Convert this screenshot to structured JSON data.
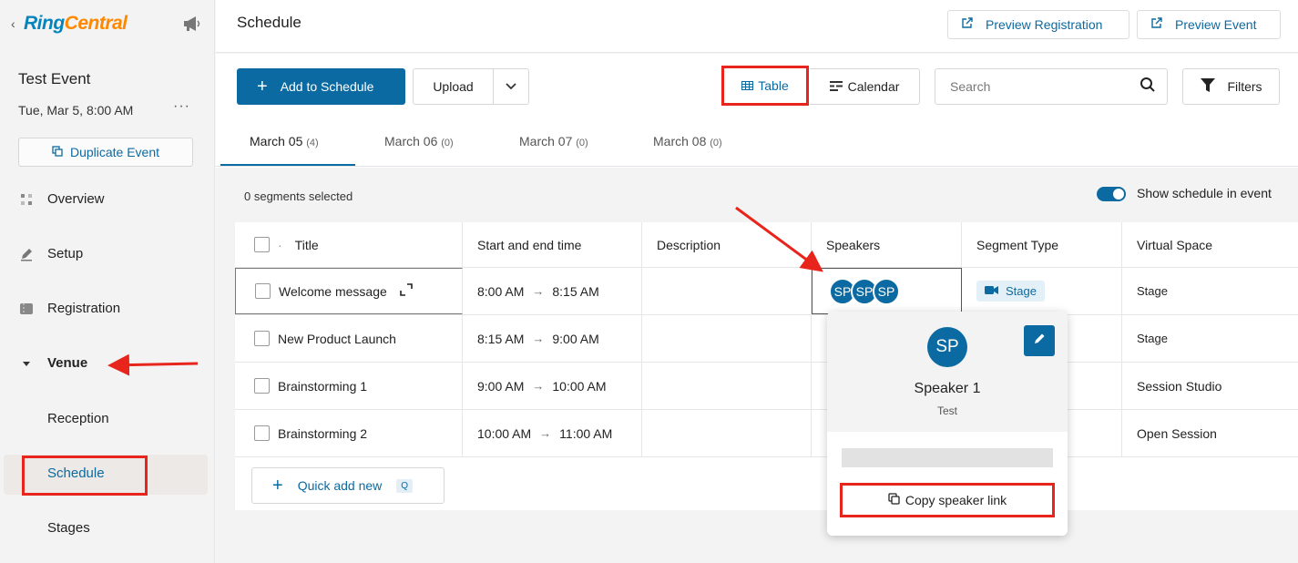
{
  "brand": {
    "logo_ring": "Ring",
    "logo_central": "Central",
    "back_icon": "chevron-left-icon",
    "announce_icon": "megaphone-icon"
  },
  "event": {
    "title": "Test Event",
    "date": "Tue, Mar 5, 8:00 AM",
    "more": "···",
    "duplicate_label": "Duplicate Event"
  },
  "nav": {
    "overview": "Overview",
    "setup": "Setup",
    "registration": "Registration",
    "venue": "Venue",
    "reception": "Reception",
    "schedule": "Schedule",
    "stages": "Stages"
  },
  "header": {
    "title": "Schedule",
    "preview_registration": "Preview Registration",
    "preview_event": "Preview Event"
  },
  "toolbar": {
    "add_label": "Add to Schedule",
    "upload_label": "Upload",
    "table_label": "Table",
    "calendar_label": "Calendar",
    "search_placeholder": "Search",
    "filters_label": "Filters"
  },
  "tabs": [
    {
      "label": "March 05",
      "count": "(4)"
    },
    {
      "label": "March 06",
      "count": "(0)"
    },
    {
      "label": "March 07",
      "count": "(0)"
    },
    {
      "label": "March 08",
      "count": "(0)"
    }
  ],
  "selection": {
    "text": "0 segments selected",
    "toggle_label": "Show schedule in event",
    "toggle_on": true
  },
  "table": {
    "columns": [
      "Title",
      "Start and end time",
      "Description",
      "Speakers",
      "Segment Type",
      "Virtual Space"
    ],
    "title_dot": "·",
    "rows": [
      {
        "title": "Welcome message",
        "start": "8:00 AM",
        "end": "8:15 AM",
        "description": "",
        "speakers": [
          "SP",
          "SP",
          "SP"
        ],
        "segment_type": "Stage",
        "virtual_space": "Stage"
      },
      {
        "title": "New Product Launch",
        "start": "8:15 AM",
        "end": "9:00 AM",
        "description": "",
        "speakers": [],
        "segment_type": "",
        "virtual_space": "Stage"
      },
      {
        "title": "Brainstorming 1",
        "start": "9:00 AM",
        "end": "10:00 AM",
        "description": "",
        "speakers": [],
        "segment_type": "",
        "virtual_space": "Session Studio"
      },
      {
        "title": "Brainstorming 2",
        "start": "10:00 AM",
        "end": "11:00 AM",
        "description": "",
        "speakers": [],
        "segment_type": "",
        "virtual_space": "Open Session"
      }
    ],
    "quick_add_label": "Quick add new",
    "quick_add_key": "Q"
  },
  "speaker_popover": {
    "avatar": "SP",
    "name": "Speaker 1",
    "subtitle": "Test",
    "copy_link_label": "Copy speaker link"
  },
  "colors": {
    "brand_blue": "#0b6aa1",
    "ring_blue": "#0684bc",
    "central_orange": "#ff8800",
    "annotation_red": "#e8251c"
  }
}
